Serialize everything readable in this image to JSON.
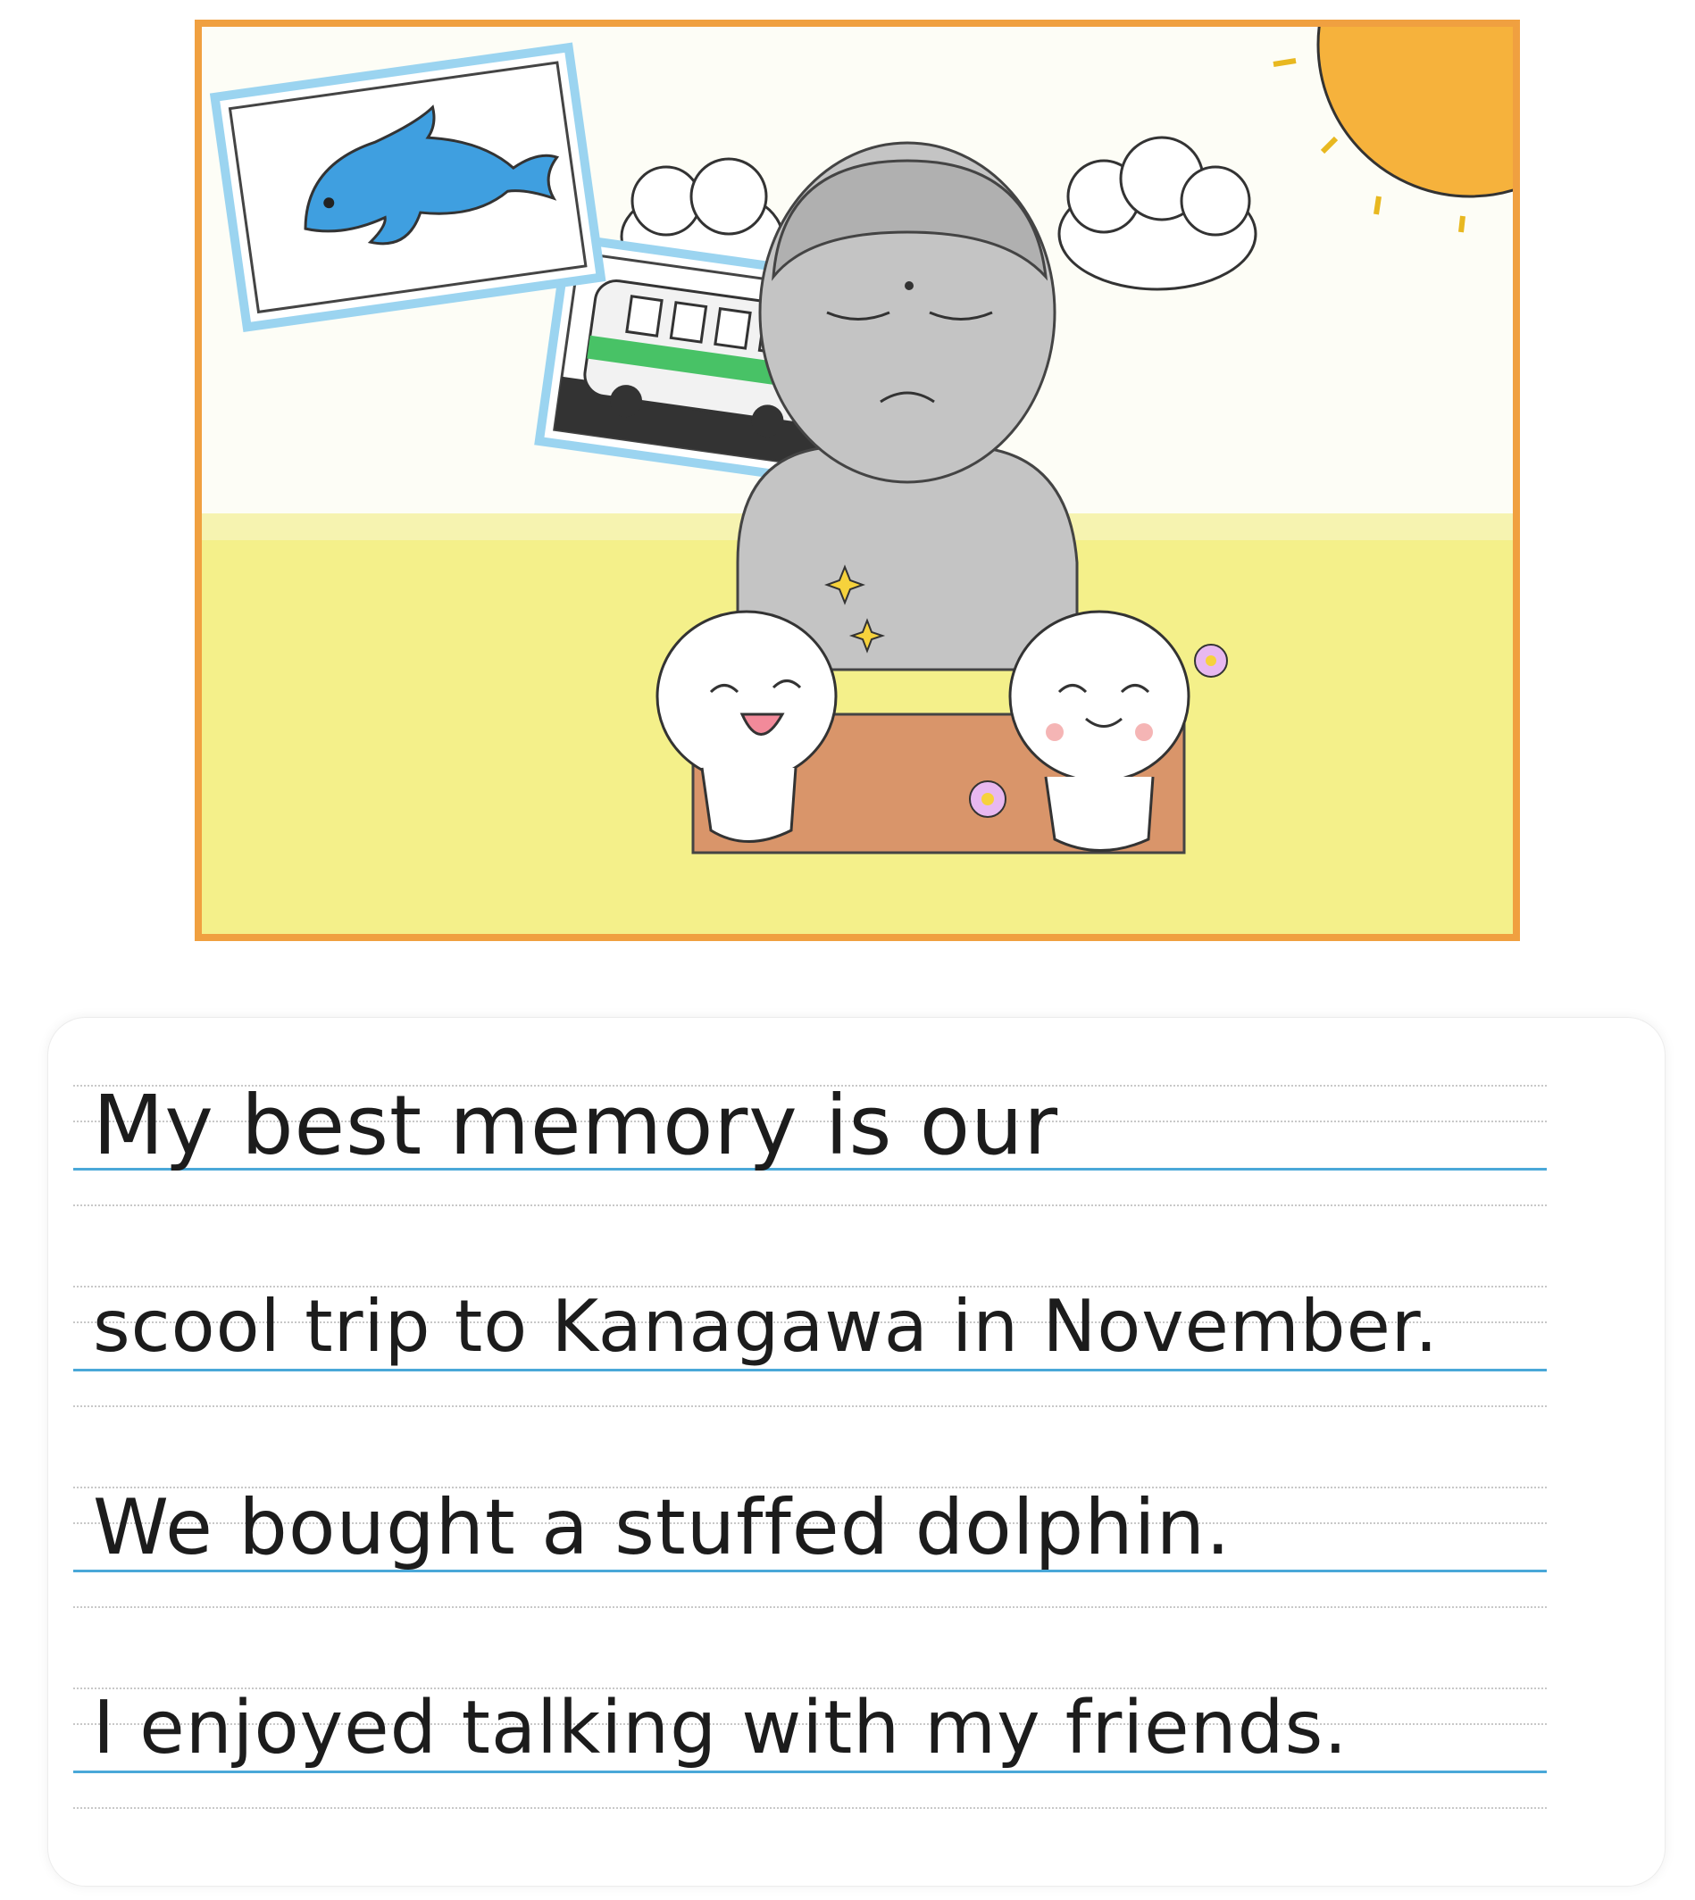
{
  "drawing": {
    "description_icons": [
      "dolphin-icon",
      "bus-icon",
      "sun-icon",
      "cloud-icon",
      "buddha-statue-icon",
      "child-figure-icon",
      "flower-icon",
      "sparkle-icon"
    ],
    "colors": {
      "frame": "#f0a040",
      "sky": "#fdfdf6",
      "grass": "#f4f08a",
      "sun": "#f6b23c",
      "dolphin": "#3f9fe0",
      "bus_stripe": "#48c266",
      "statue": "#bcbcbc",
      "box": "#d9956a",
      "cheek": "#f5b5b5"
    }
  },
  "writing": {
    "lines": [
      "My best memory is our",
      "scool trip  to Kanagawa in November.",
      "We bought a stuffed  dolphin.",
      "I enjoyed  talking  with  my  friends."
    ],
    "colors": {
      "baseline": "#4aa8d8",
      "guide": "#c8c8c8",
      "ink": "#1c1c1c"
    }
  }
}
